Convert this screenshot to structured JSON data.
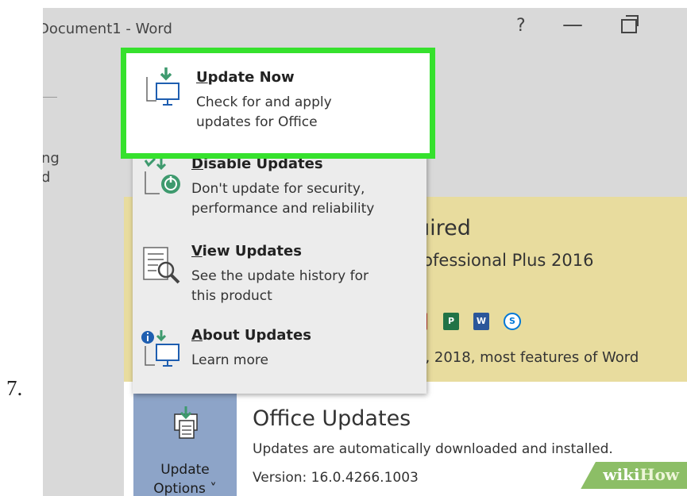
{
  "step_number": "7.",
  "window": {
    "title": "Document1 - Word",
    "help_label": "?",
    "minimize_label": "—"
  },
  "left_clip": {
    "line1": "ng",
    "line2": "d"
  },
  "license_panel": {
    "heading": "uired",
    "product": "rofessional Plus 2016",
    "date_text": "5, 2018, most features of Word",
    "app_icons": [
      "P",
      "W",
      "S"
    ]
  },
  "updates_menu": {
    "items": [
      {
        "key": "update_now",
        "title": "Update Now",
        "accel": "U",
        "title_rest": "pdate Now",
        "desc_line1": "Check for and apply",
        "desc_line2": "updates for Office"
      },
      {
        "key": "disable",
        "title": "Disable Updates",
        "accel": "D",
        "title_rest": "isable Updates",
        "desc_line1": "Don't update for security,",
        "desc_line2": "performance and reliability"
      },
      {
        "key": "view",
        "title": "View Updates",
        "accel": "V",
        "title_rest": "iew Updates",
        "desc_line1": "See the update history for",
        "desc_line2": "this product"
      },
      {
        "key": "about",
        "title": "About Updates",
        "accel": "A",
        "title_rest": "bout Updates",
        "desc_line1": "Learn more",
        "desc_line2": ""
      }
    ]
  },
  "office_updates": {
    "button_line1": "Update",
    "button_line2": "Options ˅",
    "title": "Office Updates",
    "description": "Updates are automatically downloaded and installed.",
    "version": "Version: 16.0.4266.1003"
  },
  "watermark": {
    "wiki": "wiki",
    "how": "How"
  },
  "colors": {
    "highlight_border": "#36e12d",
    "panel_yellow": "#e8dc9e",
    "update_button": "#8da4c8",
    "icon_green": "#3e9a6e",
    "icon_blue": "#1e5eb0"
  }
}
